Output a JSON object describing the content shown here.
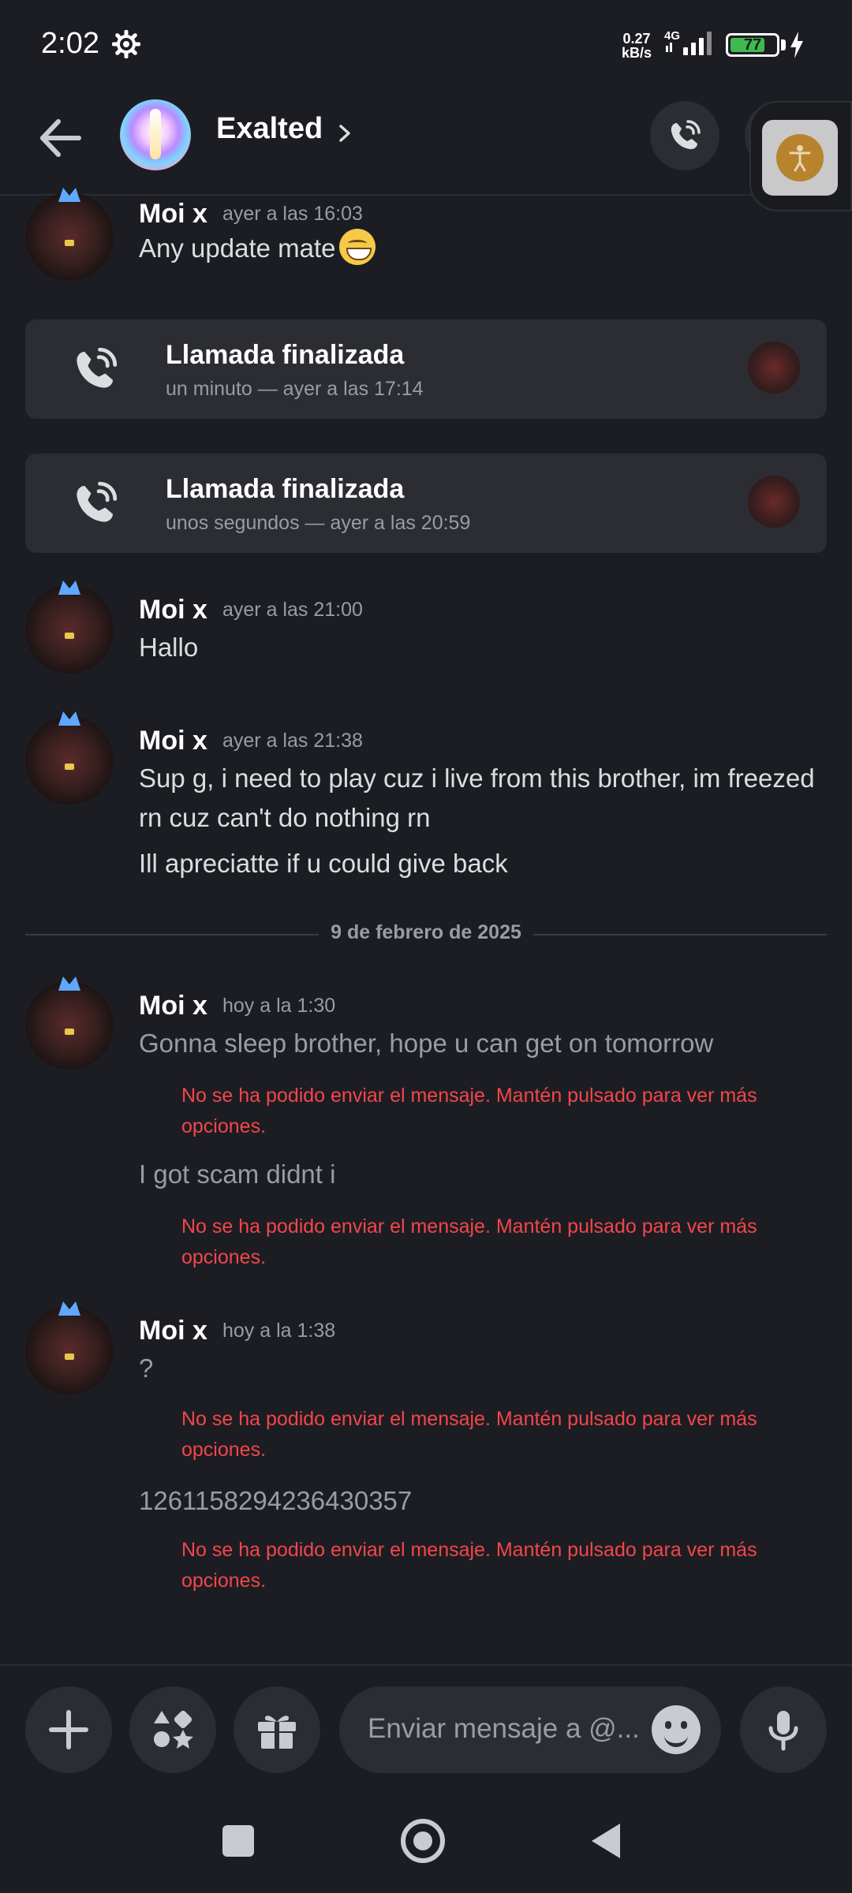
{
  "status_bar": {
    "time": "2:02",
    "net_speed_value": "0.27",
    "net_speed_unit": "kB/s",
    "network": "4G",
    "battery": "77",
    "battery_level": 0.77
  },
  "header": {
    "contact_name": "Exalted",
    "icons": [
      "back-arrow-icon",
      "chevron-right-icon",
      "phone-call-icon"
    ]
  },
  "messages": [
    {
      "author": "Moi x",
      "timestamp": "ayer a las 16:03",
      "lines": [
        "Any update mate"
      ],
      "emoji": "grinning-face"
    },
    {
      "type": "call",
      "title": "Llamada finalizada",
      "subtitle": "un minuto — ayer a las 17:14"
    },
    {
      "type": "call",
      "title": "Llamada finalizada",
      "subtitle": "unos segundos — ayer a las 20:59"
    },
    {
      "author": "Moi x",
      "timestamp": "ayer a las 21:00",
      "lines": [
        "Hallo"
      ]
    },
    {
      "author": "Moi x",
      "timestamp": "ayer a las 21:38",
      "lines": [
        "Sup g, i need to play cuz i live from this brother, im freezed rn cuz can't do nothing rn",
        "Ill apreciatte if u could give back"
      ]
    },
    {
      "author": "Moi x",
      "timestamp": "hoy a la 1:30",
      "lines": [
        "Gonna sleep brother, hope u can get on tomorrow",
        "I got scam didnt i"
      ]
    },
    {
      "author": "Moi x",
      "timestamp": "hoy a la 1:38",
      "lines": [
        "?",
        "1261158294236430357"
      ]
    }
  ],
  "date_divider": "9 de febrero de 2025",
  "send_error": "No se ha podido enviar el mensaje. Mantén pulsado para ver más opciones.",
  "composer": {
    "placeholder": "Enviar mensaje a @...",
    "icons": [
      "plus-icon",
      "apps-icon",
      "gift-icon",
      "emoji-icon",
      "microphone-icon"
    ]
  },
  "colors": {
    "background": "#1c1d22",
    "card": "#2b2d33",
    "error": "#f2464b",
    "muted": "#9a9ca3",
    "battery": "#3fb950"
  }
}
